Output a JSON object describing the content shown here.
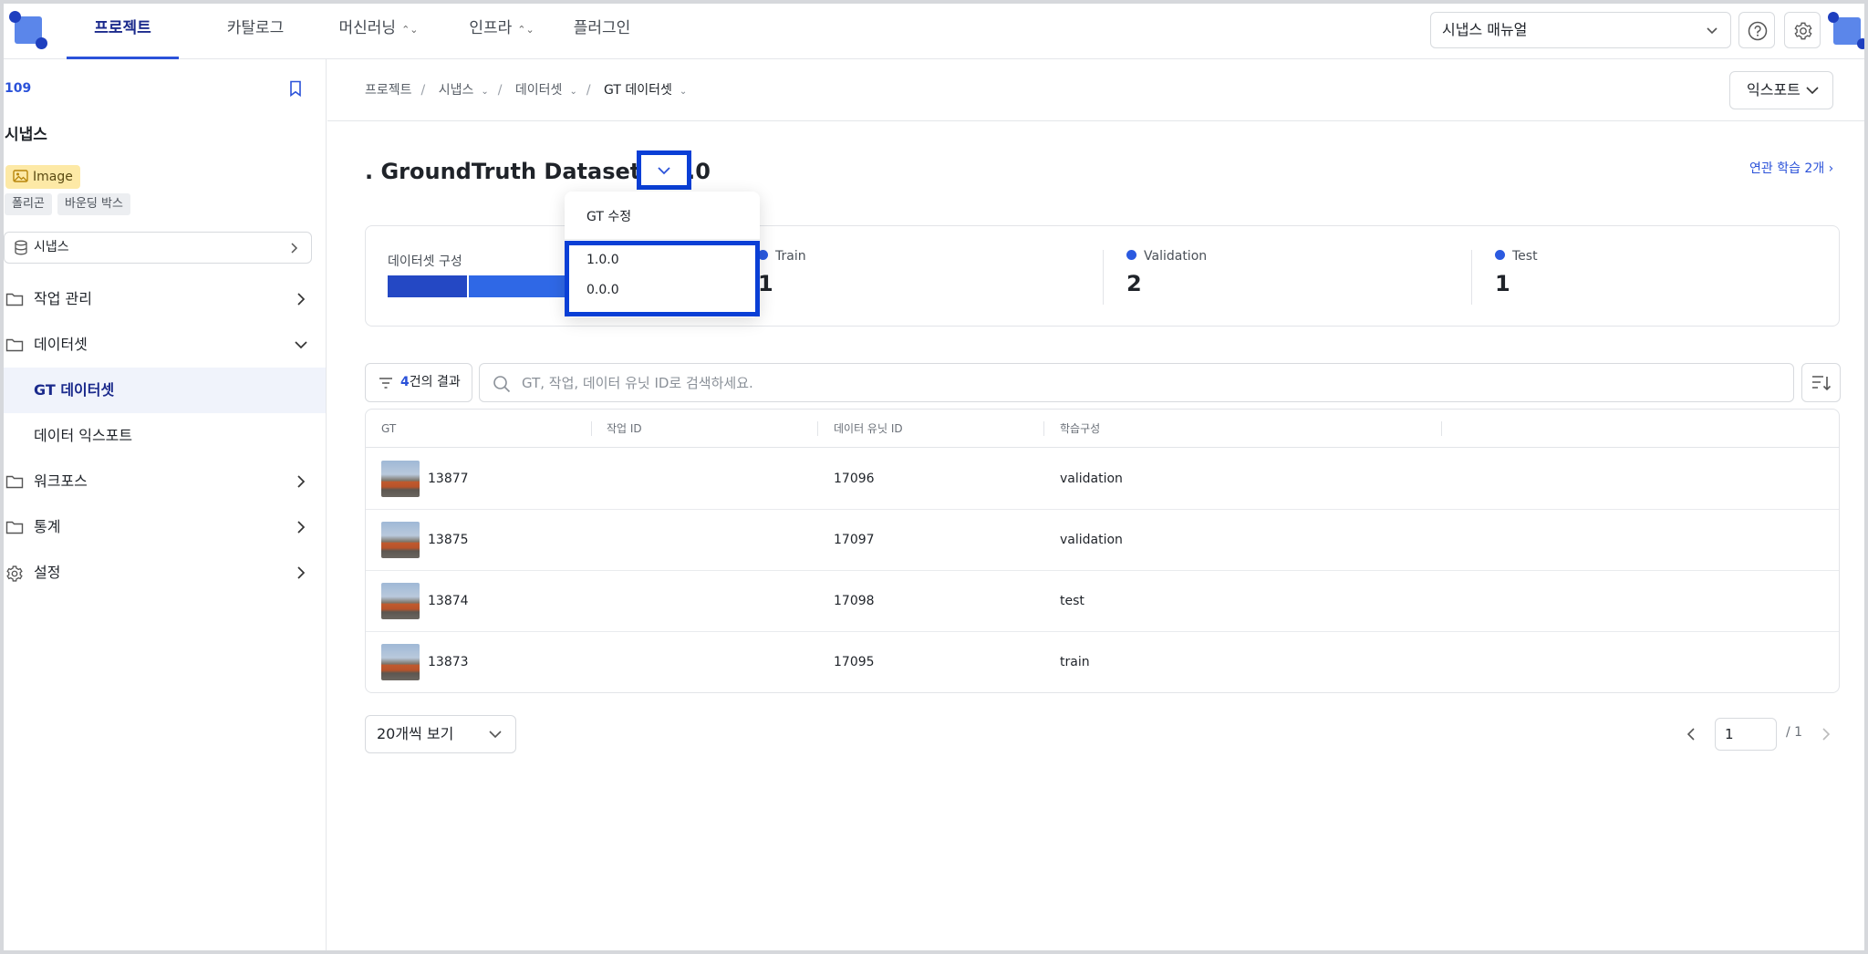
{
  "topnav": {
    "tabs": [
      {
        "label": "프로젝트",
        "active": true
      },
      {
        "label": "카탈로그"
      },
      {
        "label": "머신러닝"
      },
      {
        "label": "인프라"
      },
      {
        "label": "플러그인"
      }
    ],
    "manual_label": "시냅스 매뉴얼",
    "icons": [
      "help-icon",
      "gear-icon"
    ]
  },
  "sidebar": {
    "project_id": "109",
    "project_name": "시냅스",
    "data_type": "Image",
    "tags": [
      "폴리곤",
      "바운딩 박스"
    ],
    "dataset": "시냅스",
    "items": [
      {
        "label": "작업 관리",
        "icon": "folder-icon",
        "expanded": false
      },
      {
        "label": "데이터셋",
        "icon": "folder-icon",
        "expanded": true
      },
      {
        "label": "워크포스",
        "icon": "folder-icon",
        "expanded": false
      },
      {
        "label": "통계",
        "icon": "folder-icon",
        "expanded": false
      },
      {
        "label": "설정",
        "icon": "gear-icon",
        "expanded": false
      }
    ],
    "subitems": [
      {
        "label": "GT 데이터셋",
        "active": true
      },
      {
        "label": "데이터 익스포트"
      }
    ]
  },
  "breadcrumb": [
    "프로젝트",
    "시냅스",
    "데이터셋",
    "GT 데이터셋"
  ],
  "export_label": "익스포트",
  "title": ". GroundTruth Dataset 1.0.0",
  "related_label": "연관 학습 2개",
  "stats": {
    "composition_label": "데이터셋 구성",
    "items": [
      {
        "name": "Train",
        "count": "1"
      },
      {
        "name": "Validation",
        "count": "2"
      },
      {
        "name": "Test",
        "count": "1"
      }
    ],
    "segment_colors": [
      "#2448c4",
      "#2f68e6",
      "#2f68e6"
    ]
  },
  "filter": {
    "count": "4",
    "label": "건의 결과"
  },
  "search": {
    "placeholder": "GT, 작업, 데이터 유닛 ID로 검색하세요."
  },
  "table": {
    "headers": [
      "GT",
      "작업 ID",
      "데이터 유닛 ID",
      "학습구성"
    ],
    "rows": [
      {
        "gt": "13877",
        "task": "",
        "unit": "17096",
        "split": "validation"
      },
      {
        "gt": "13875",
        "task": "",
        "unit": "17097",
        "split": "validation"
      },
      {
        "gt": "13874",
        "task": "",
        "unit": "17098",
        "split": "test"
      },
      {
        "gt": "13873",
        "task": "",
        "unit": "17095",
        "split": "train"
      }
    ]
  },
  "pagination": {
    "page_size_label": "20개씩 보기",
    "current": "1",
    "total": "/ 1"
  },
  "dropdown": {
    "edit_label": "GT 수정",
    "versions": [
      "1.0.0",
      "0.0.0"
    ]
  },
  "colors": {
    "accent": "#2b52d9",
    "highlight": "#0a3fd6",
    "badge": "#fde9a6"
  }
}
